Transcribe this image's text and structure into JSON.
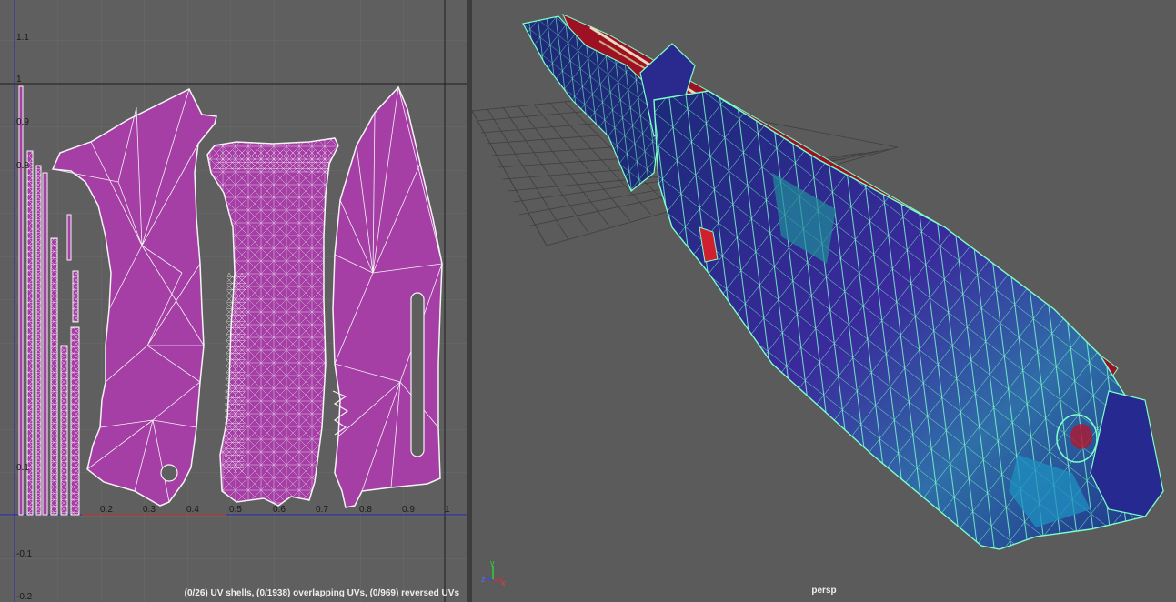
{
  "uv_editor": {
    "u_ticks": [
      "0.2",
      "0.3",
      "0.4",
      "0.5",
      "0.6",
      "0.7",
      "0.8",
      "0.9",
      "1"
    ],
    "v_ticks": [
      "1.1",
      "1",
      "0.9",
      "0.8",
      "0.1",
      "-0.1",
      "-0.2"
    ],
    "status": "(0/26) UV shells, (0/1938) overlapping UVs, (0/969) reversed UVs"
  },
  "viewport": {
    "camera": "persp",
    "axis_labels": {
      "y": "y",
      "z": "z",
      "x": "x"
    }
  },
  "colors": {
    "uv_shell_fill": "#a53fa5",
    "uv_wire": "#f4f4f4",
    "wireframe": "#7dffc8",
    "mesh_blue": "#2b2f8f",
    "mesh_red": "#b0102a"
  }
}
